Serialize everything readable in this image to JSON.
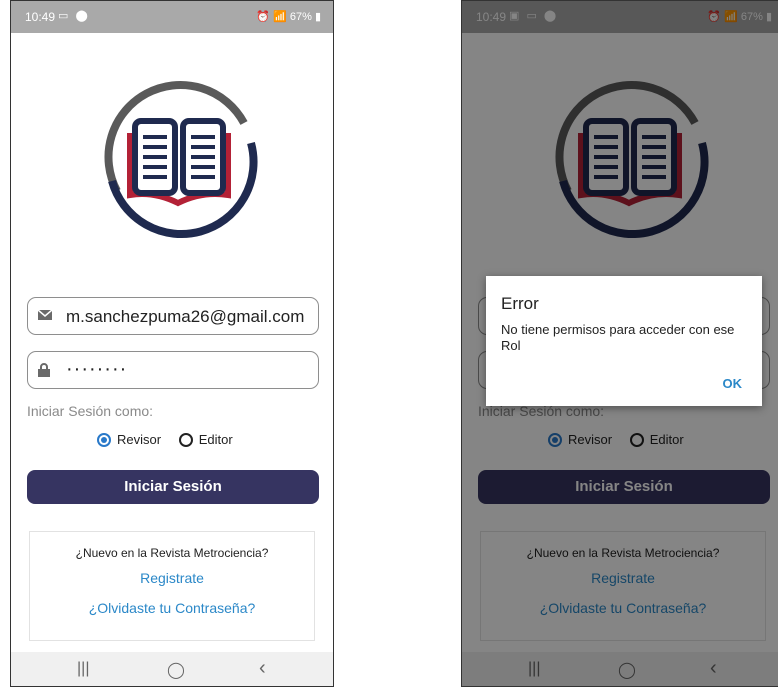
{
  "status_bar": {
    "time": "10:49",
    "battery": "67%"
  },
  "login": {
    "email_value": "m.sanchezpuma26@gmail.com",
    "password_mask": "········",
    "login_as_label": "Iniciar Sesión como:",
    "role_options": [
      "Revisor",
      "Editor"
    ],
    "selected_role": "Revisor",
    "submit_label": "Iniciar Sesión"
  },
  "signup_card": {
    "question": "¿Nuevo en la Revista Metrociencia?",
    "register_link": "Registrate",
    "forgot_link": "¿Olvidaste tu Contraseña?"
  },
  "nav_bar": {
    "recents": "|||",
    "home": "◯",
    "back": "‹"
  },
  "dialog": {
    "title": "Error",
    "message": "No tiene permisos para acceder con ese Rol",
    "ok_label": "OK"
  },
  "colors": {
    "primary_button": "#363461",
    "link": "#2b88c8",
    "radio_selected": "#2979c9",
    "logo_navy": "#1f2a4f",
    "logo_red": "#b32136"
  }
}
